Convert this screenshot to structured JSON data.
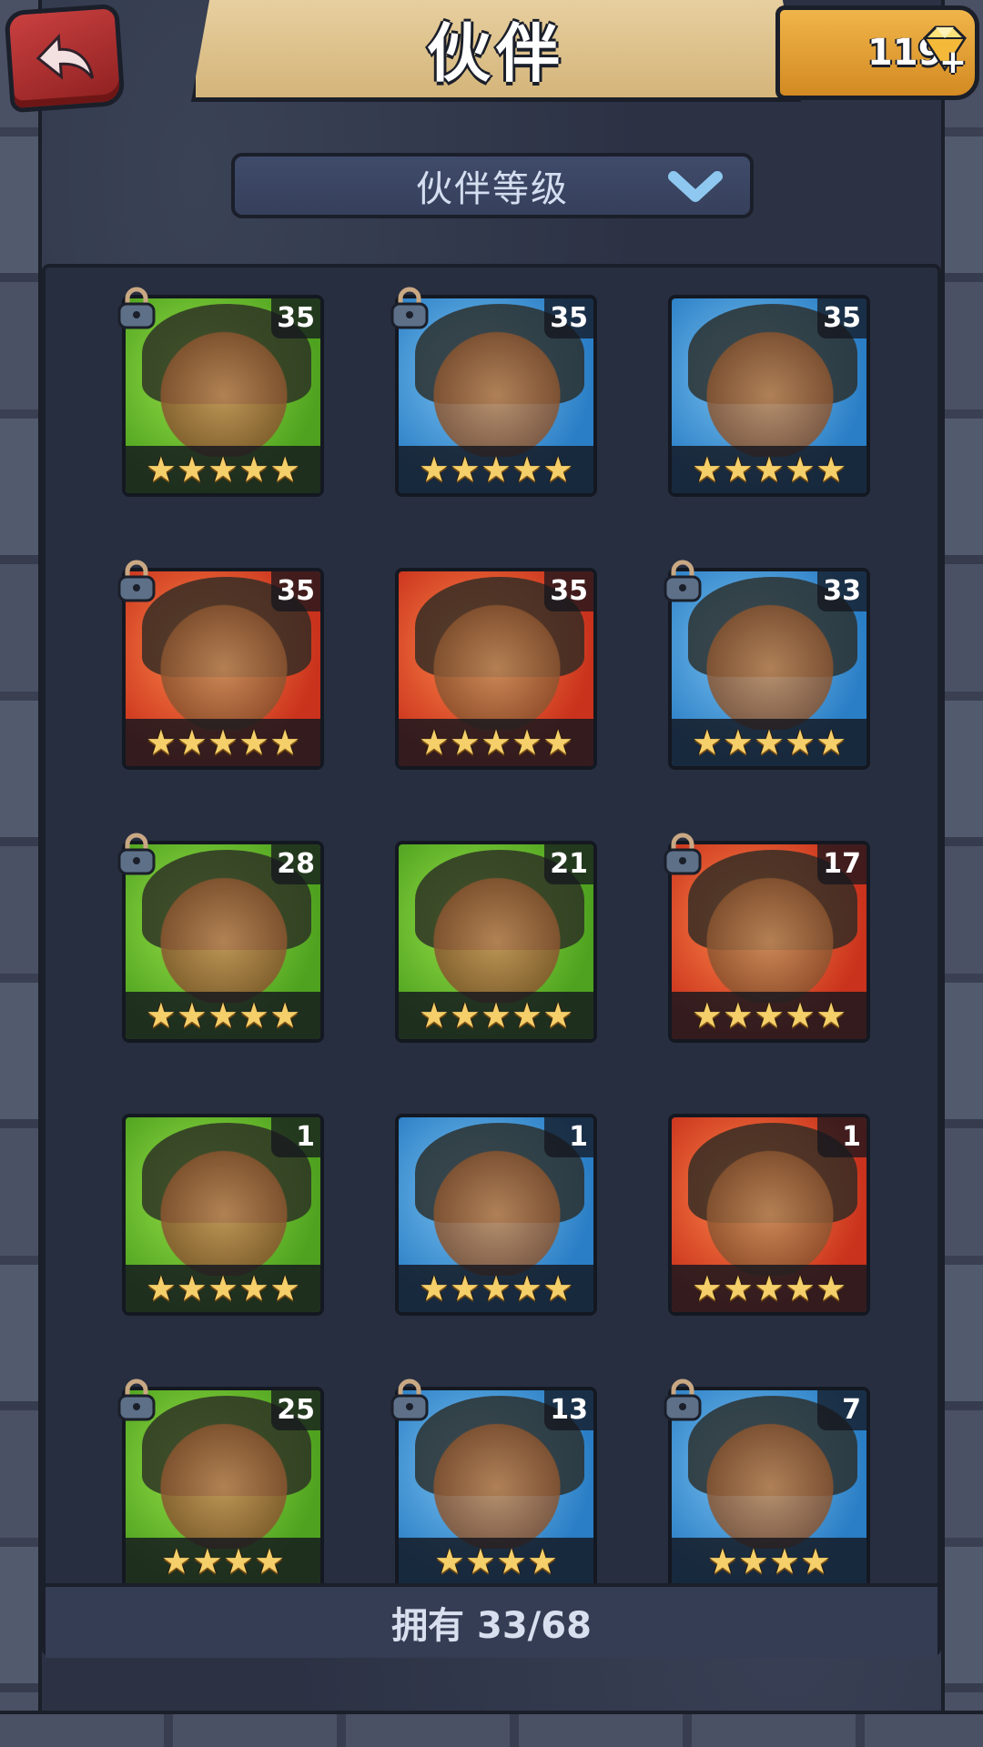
{
  "header": {
    "title": "伙伴",
    "back_icon": "back-arrow-icon",
    "gems": "119",
    "gem_icon": "gem-icon"
  },
  "sort": {
    "label": "伙伴等级",
    "chevron_icon": "chevron-down-icon"
  },
  "colors": {
    "green": "#6cc42b",
    "blue": "#3a8fd6",
    "red": "#e0502a",
    "star": "#f4cf6a",
    "gem_panel": "#e8a535",
    "back_button": "#b83030"
  },
  "partners": [
    {
      "level": "35",
      "stars": "★★★★★",
      "bg": "green",
      "locked": true
    },
    {
      "level": "35",
      "stars": "★★★★★",
      "bg": "blue",
      "locked": true
    },
    {
      "level": "35",
      "stars": "★★★★★",
      "bg": "blue",
      "locked": false
    },
    {
      "level": "35",
      "stars": "★★★★★",
      "bg": "red",
      "locked": true
    },
    {
      "level": "35",
      "stars": "★★★★★",
      "bg": "red",
      "locked": false
    },
    {
      "level": "33",
      "stars": "★★★★★",
      "bg": "blue",
      "locked": true
    },
    {
      "level": "28",
      "stars": "★★★★★",
      "bg": "green",
      "locked": true
    },
    {
      "level": "21",
      "stars": "★★★★★",
      "bg": "green",
      "locked": false
    },
    {
      "level": "17",
      "stars": "★★★★★",
      "bg": "red",
      "locked": true
    },
    {
      "level": "1",
      "stars": "★★★★★",
      "bg": "green",
      "locked": false
    },
    {
      "level": "1",
      "stars": "★★★★★",
      "bg": "blue",
      "locked": false
    },
    {
      "level": "1",
      "stars": "★★★★★",
      "bg": "red",
      "locked": false
    },
    {
      "level": "25",
      "stars": "★★★★",
      "bg": "green",
      "locked": true
    },
    {
      "level": "13",
      "stars": "★★★★",
      "bg": "blue",
      "locked": true
    },
    {
      "level": "7",
      "stars": "★★★★",
      "bg": "blue",
      "locked": true
    }
  ],
  "footer": {
    "owned_text": "拥有 33/68"
  }
}
